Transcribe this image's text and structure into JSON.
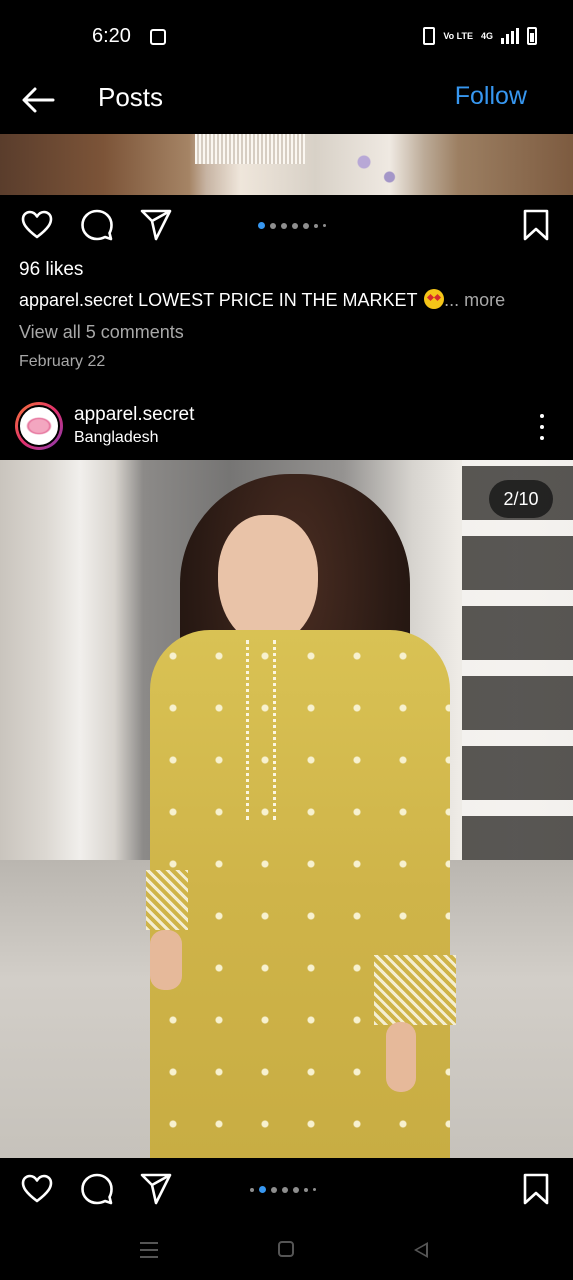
{
  "status_bar": {
    "time": "6:20",
    "network": "4G",
    "volte": "Vo LTE"
  },
  "header": {
    "title": "Posts",
    "follow_label": "Follow",
    "back_icon": "arrow-left-icon"
  },
  "post1": {
    "likes": "96 likes",
    "caption_user": "apparel.secret",
    "caption_text": " LOWEST PRICE IN THE MARKET ",
    "caption_more": "... more",
    "comments_link": "View all 5 comments",
    "date": "February 22",
    "carousel_index": 1,
    "carousel_total_dots": 7
  },
  "post2": {
    "username": "apparel.secret",
    "location": "Bangladesh",
    "image_counter": "2/10",
    "carousel_index": 1,
    "carousel_total_dots": 7
  },
  "colors": {
    "accent": "#3797f0",
    "muted_text": "#a8a8a8",
    "background": "#000000"
  },
  "icons": {
    "like": "heart-icon",
    "comment": "comment-bubble-icon",
    "share": "paper-plane-icon",
    "save": "bookmark-icon",
    "more": "more-vertical-icon"
  }
}
